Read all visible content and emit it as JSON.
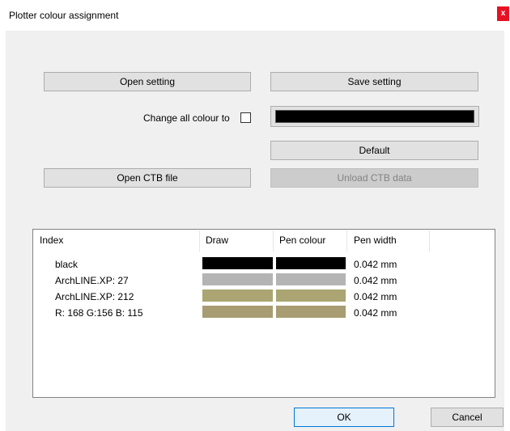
{
  "window": {
    "title": "Plotter colour assignment",
    "close_label": "x"
  },
  "buttons": {
    "open_setting": "Open setting",
    "save_setting": "Save setting",
    "default": "Default",
    "open_ctb": "Open CTB file",
    "unload_ctb": "Unload CTB data",
    "ok": "OK",
    "cancel": "Cancel"
  },
  "change_all": {
    "label": "Change all colour to",
    "checked": false,
    "colour": "#000000"
  },
  "table": {
    "columns": [
      "Index",
      "Draw",
      "Pen colour",
      "Pen width"
    ],
    "rows": [
      {
        "index": "black",
        "draw": "#000000",
        "pen": "#000000",
        "width": "0.042 mm"
      },
      {
        "index": "ArchLINE.XP: 27",
        "draw": "#b4b4b4",
        "pen": "#b4b4b4",
        "width": "0.042 mm"
      },
      {
        "index": "ArchLINE.XP: 212",
        "draw": "#aaa572",
        "pen": "#aaa572",
        "width": "0.042 mm"
      },
      {
        "index": "R: 168 G:156 B: 115",
        "draw": "#a89c73",
        "pen": "#a89c73",
        "width": "0.042 mm"
      }
    ]
  }
}
